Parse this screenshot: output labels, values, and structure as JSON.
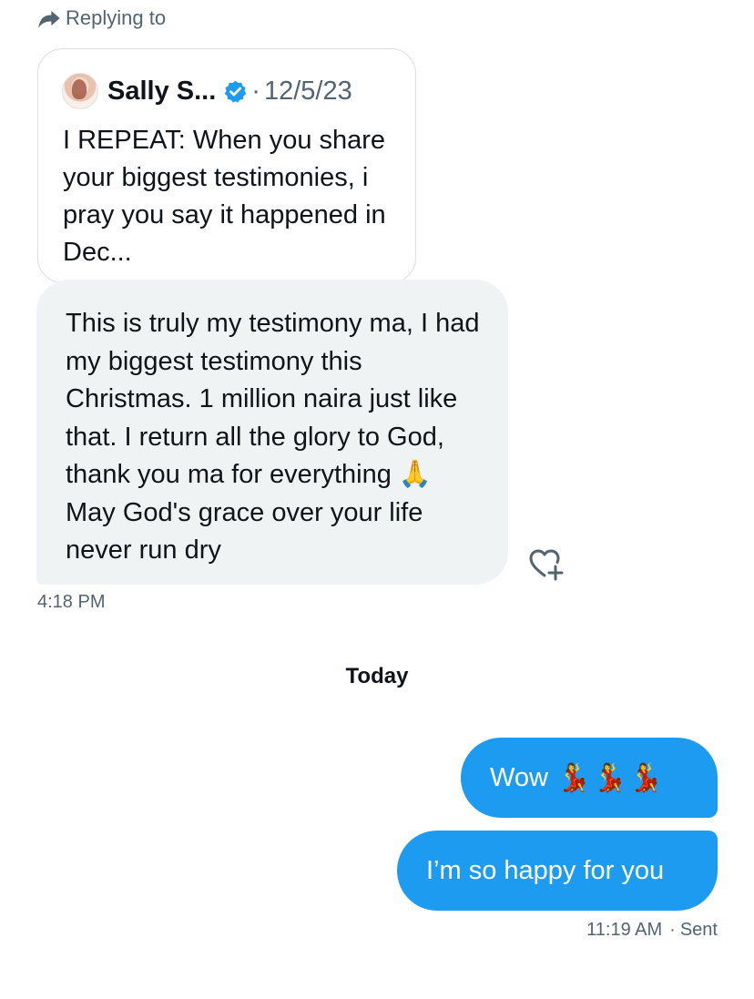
{
  "reply_header": {
    "icon": "reply-arrow-icon",
    "label": "Replying to"
  },
  "quoted_post": {
    "author_name": "Sally S...",
    "verified_icon": "verified-badge-icon",
    "separator": "·",
    "date": "12/5/23",
    "text": "I REPEAT: When you share your biggest testimonies, i pray you say it happened in Dec..."
  },
  "received_message": {
    "text": "This is truly my testimony ma, I had my biggest testimony this Christmas. 1 million naira just like that. I return all the glory to God, thank you ma for everything 🙏 May God's grace over your life never run dry",
    "timestamp": "4:18 PM",
    "react_icon": "add-reaction-heart-icon"
  },
  "day_separator": "Today",
  "sent_messages": [
    {
      "text": "Wow",
      "emoji": "💃💃💃"
    },
    {
      "text": "I’m so happy for you"
    }
  ],
  "sent_status": {
    "time": "11:19 AM",
    "separator": "·",
    "status": "Sent"
  },
  "colors": {
    "accent": "#1d9bf0",
    "received_bubble": "#eff3f4",
    "secondary_text": "#536471",
    "primary_text": "#0f1419"
  }
}
